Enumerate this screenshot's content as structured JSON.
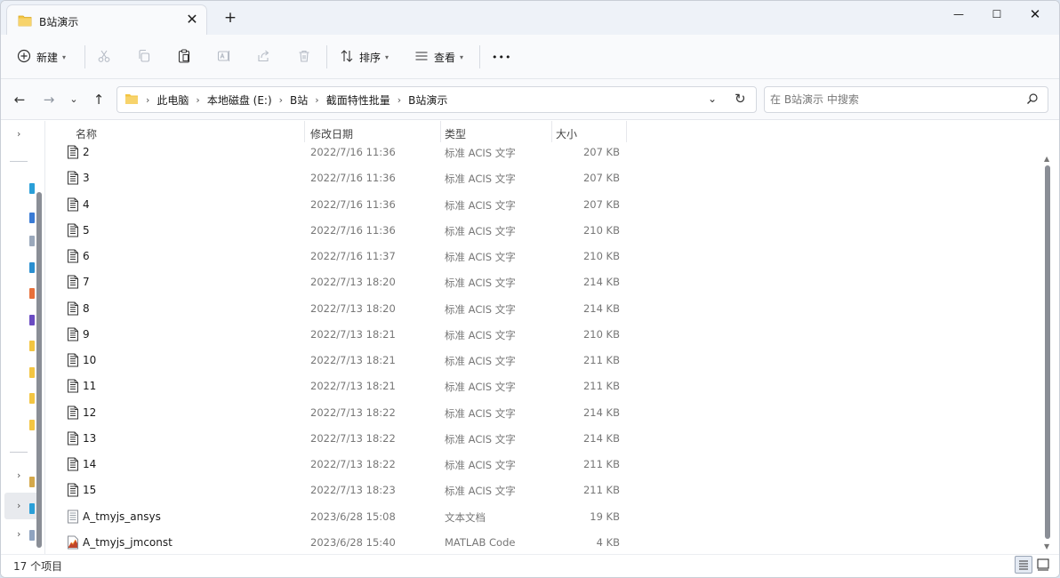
{
  "window": {
    "tab_title": "B站演示",
    "tab_close": "✕",
    "new_tab": "+"
  },
  "window_controls": {
    "minimize": "—",
    "maximize": "☐",
    "close": "✕"
  },
  "toolbar": {
    "new_label": "新建",
    "sort_label": "排序",
    "view_label": "查看",
    "more_label": "•••",
    "icons": [
      "plus-circle-icon",
      "cut-icon",
      "copy-icon",
      "paste-icon",
      "rename-icon",
      "share-icon",
      "delete-icon",
      "sort-icon",
      "view-icon",
      "more-icon"
    ]
  },
  "address": {
    "crumbs": [
      "此电脑",
      "本地磁盘 (E:)",
      "B站",
      "截面特性批量",
      "B站演示"
    ]
  },
  "search": {
    "placeholder": "在 B站演示 中搜索"
  },
  "columns": {
    "name": "名称",
    "date": "修改日期",
    "type": "类型",
    "size": "大小"
  },
  "files": [
    {
      "name": "2",
      "date": "2022/7/16 11:36",
      "type": "标准 ACIS 文字",
      "size": "207 KB",
      "icon": "acis-file-icon"
    },
    {
      "name": "3",
      "date": "2022/7/16 11:36",
      "type": "标准 ACIS 文字",
      "size": "207 KB",
      "icon": "acis-file-icon"
    },
    {
      "name": "4",
      "date": "2022/7/16 11:36",
      "type": "标准 ACIS 文字",
      "size": "207 KB",
      "icon": "acis-file-icon"
    },
    {
      "name": "5",
      "date": "2022/7/16 11:36",
      "type": "标准 ACIS 文字",
      "size": "210 KB",
      "icon": "acis-file-icon"
    },
    {
      "name": "6",
      "date": "2022/7/16 11:37",
      "type": "标准 ACIS 文字",
      "size": "210 KB",
      "icon": "acis-file-icon"
    },
    {
      "name": "7",
      "date": "2022/7/13 18:20",
      "type": "标准 ACIS 文字",
      "size": "214 KB",
      "icon": "acis-file-icon"
    },
    {
      "name": "8",
      "date": "2022/7/13 18:20",
      "type": "标准 ACIS 文字",
      "size": "214 KB",
      "icon": "acis-file-icon"
    },
    {
      "name": "9",
      "date": "2022/7/13 18:21",
      "type": "标准 ACIS 文字",
      "size": "210 KB",
      "icon": "acis-file-icon"
    },
    {
      "name": "10",
      "date": "2022/7/13 18:21",
      "type": "标准 ACIS 文字",
      "size": "211 KB",
      "icon": "acis-file-icon"
    },
    {
      "name": "11",
      "date": "2022/7/13 18:21",
      "type": "标准 ACIS 文字",
      "size": "211 KB",
      "icon": "acis-file-icon"
    },
    {
      "name": "12",
      "date": "2022/7/13 18:22",
      "type": "标准 ACIS 文字",
      "size": "214 KB",
      "icon": "acis-file-icon"
    },
    {
      "name": "13",
      "date": "2022/7/13 18:22",
      "type": "标准 ACIS 文字",
      "size": "214 KB",
      "icon": "acis-file-icon"
    },
    {
      "name": "14",
      "date": "2022/7/13 18:22",
      "type": "标准 ACIS 文字",
      "size": "211 KB",
      "icon": "acis-file-icon"
    },
    {
      "name": "15",
      "date": "2022/7/13 18:23",
      "type": "标准 ACIS 文字",
      "size": "211 KB",
      "icon": "acis-file-icon"
    },
    {
      "name": "A_tmyjs_ansys",
      "date": "2023/6/28 15:08",
      "type": "文本文档",
      "size": "19 KB",
      "icon": "text-file-icon"
    },
    {
      "name": "A_tmyjs_jmconst",
      "date": "2023/6/28 15:40",
      "type": "MATLAB Code",
      "size": "4 KB",
      "icon": "matlab-file-icon"
    }
  ],
  "status": {
    "item_count": "17 个项目"
  },
  "colors": {
    "folder": "#f3c542",
    "accent": "#0a64c8"
  }
}
